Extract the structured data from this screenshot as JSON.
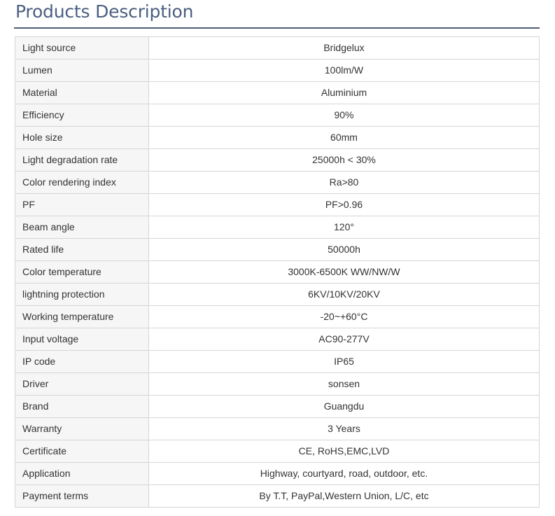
{
  "title": "Products Description",
  "specs": [
    {
      "label": "Light source",
      "value": "Bridgelux"
    },
    {
      "label": "Lumen",
      "value": "100lm/W"
    },
    {
      "label": "Material",
      "value": "Aluminium"
    },
    {
      "label": "Efficiency",
      "value": "90%"
    },
    {
      "label": "Hole size",
      "value": "60mm"
    },
    {
      "label": "Light degradation rate",
      "value": "25000h < 30%"
    },
    {
      "label": "Color rendering index",
      "value": "Ra>80"
    },
    {
      "label": "PF",
      "value": "PF>0.96"
    },
    {
      "label": "Beam angle",
      "value": "120°"
    },
    {
      "label": "Rated life",
      "value": "50000h"
    },
    {
      "label": "Color temperature",
      "value": "3000K-6500K WW/NW/W"
    },
    {
      "label": "lightning protection",
      "value": "6KV/10KV/20KV"
    },
    {
      "label": "Working temperature",
      "value": "-20~+60°C"
    },
    {
      "label": "Input voltage",
      "value": "AC90-277V"
    },
    {
      "label": "IP code",
      "value": "IP65"
    },
    {
      "label": "Driver",
      "value": "sonsen"
    },
    {
      "label": "Brand",
      "value": "Guangdu"
    },
    {
      "label": "Warranty",
      "value": "3 Years"
    },
    {
      "label": "Certificate",
      "value": "CE, RoHS,EMC,LVD"
    },
    {
      "label": "Application",
      "value": "Highway, courtyard, road, outdoor, etc."
    },
    {
      "label": "Payment terms",
      "value": "By T.T, PayPal,Western Union, L/C, etc"
    }
  ]
}
